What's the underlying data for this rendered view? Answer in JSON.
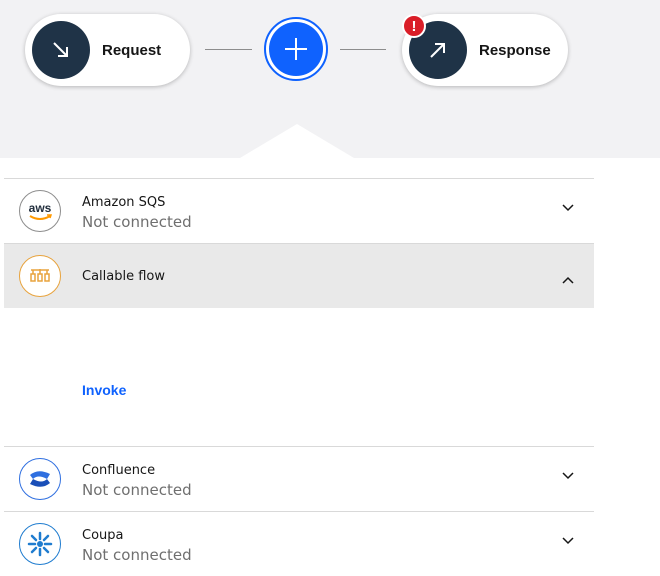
{
  "flow": {
    "request": {
      "label": "Request",
      "icon": "arrow-down-right-icon"
    },
    "add": {
      "icon": "plus-icon"
    },
    "response": {
      "label": "Response",
      "icon": "arrow-up-right-icon",
      "warning": "!"
    }
  },
  "colors": {
    "node_dark": "#1f3347",
    "accent": "#0f62fe",
    "warning": "#da1e28",
    "callable_orange": "#e8a33d",
    "confluence_blue": "#2f6fe0",
    "coupa_blue": "#1f7ccf"
  },
  "connectors": [
    {
      "name": "Amazon SQS",
      "status": "Not connected",
      "icon": "aws-icon",
      "expanded": false
    },
    {
      "name": "Callable flow",
      "status": "",
      "icon": "callable-flow-icon",
      "expanded": true,
      "actions": [
        "Invoke"
      ]
    },
    {
      "name": "Confluence",
      "status": "Not connected",
      "icon": "confluence-icon",
      "expanded": false
    },
    {
      "name": "Coupa",
      "status": "Not connected",
      "icon": "coupa-icon",
      "expanded": false
    }
  ]
}
